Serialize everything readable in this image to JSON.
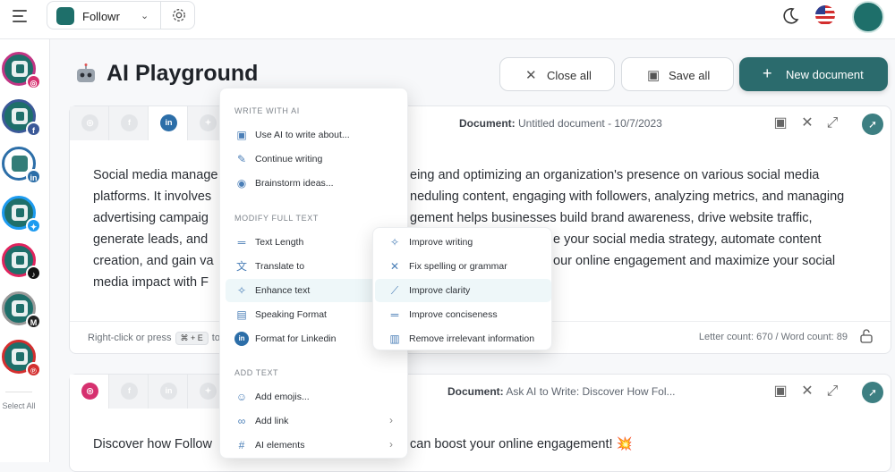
{
  "app": {
    "name": "Followr"
  },
  "colors": {
    "brand": "#1e6f6a",
    "accent": "#2b6b6d",
    "menu_icon": "#4b7fb7"
  },
  "sidebar": {
    "accounts": [
      {
        "network": "instagram",
        "badge_icon": "instagram-icon",
        "badge_color": "#d6306f"
      },
      {
        "network": "facebook",
        "badge_icon": "facebook-icon",
        "badge_color": "#3b5998",
        "badge_text": "f"
      },
      {
        "network": "linkedin",
        "badge_icon": "linkedin-icon",
        "badge_color": "#2c6ea8",
        "badge_text": "in"
      },
      {
        "network": "twitter",
        "badge_icon": "twitter-icon",
        "badge_color": "#1d9bf0"
      },
      {
        "network": "tiktok",
        "badge_icon": "tiktok-icon",
        "badge_color": "#111111"
      },
      {
        "network": "medium",
        "badge_icon": "medium-icon",
        "badge_color": "#222222",
        "badge_text": "M"
      },
      {
        "network": "pinterest",
        "badge_icon": "pinterest-icon",
        "badge_color": "#d32f2f"
      }
    ],
    "select_all": "Select All"
  },
  "page": {
    "title": "AI Playground"
  },
  "toolbar": {
    "close_all": "Close all",
    "save_all": "Save all",
    "new_document": "New document"
  },
  "documents": [
    {
      "label_prefix": "Document:",
      "label_value": "Untitled document - 10/7/2023",
      "lines": [
        "Social media manage",
        "platforms. It involves",
        "advertising campaig",
        "generate leads, and",
        "creation, and gain va",
        "media impact with F"
      ],
      "lines_right": [
        "eing and optimizing an organization's presence on various social media",
        "neduling content, engaging with followers, analyzing metrics, and managing",
        "gement helps businesses build brand awareness, drive website traffic,",
        "e your social media strategy, automate content",
        "our online engagement and maximize your social",
        ""
      ],
      "hint_prefix": "Right-click or press",
      "hint_key": "⌘ + E",
      "hint_suffix": "to",
      "counts": "Letter count: 670 / Word count: 89"
    },
    {
      "label_prefix": "Document:",
      "label_value": "Ask AI to Write: Discover How Fol...",
      "text_left": "Discover how Follow",
      "text_right": "can boost your online engagement! 💥"
    }
  ],
  "context_menu": {
    "write_with_ai": {
      "title": "WRITE WITH AI",
      "items": [
        {
          "label": "Use AI to write about...",
          "icon": "ai-chip-icon"
        },
        {
          "label": "Continue writing",
          "icon": "pencil-icon"
        },
        {
          "label": "Brainstorm ideas...",
          "icon": "lightbulb-icon"
        }
      ]
    },
    "modify_full_text": {
      "title": "MODIFY FULL TEXT",
      "items": [
        {
          "label": "Text Length",
          "icon": "text-length-icon"
        },
        {
          "label": "Translate to",
          "icon": "translate-icon"
        },
        {
          "label": "Enhance text",
          "icon": "magic-wand-icon"
        },
        {
          "label": "Speaking Format",
          "icon": "paint-roller-icon"
        },
        {
          "label": "Format for Linkedin",
          "icon": "linkedin-icon"
        }
      ]
    },
    "add_text": {
      "title": "ADD TEXT",
      "items": [
        {
          "label": "Add emojis...",
          "icon": "smiley-icon"
        },
        {
          "label": "Add link",
          "icon": "link-icon"
        },
        {
          "label": "AI elements",
          "icon": "hash-icon"
        }
      ]
    }
  },
  "submenu": {
    "items": [
      {
        "label": "Improve writing",
        "icon": "sparkle-wand-icon"
      },
      {
        "label": "Fix spelling or grammar",
        "icon": "tools-icon"
      },
      {
        "label": "Improve clarity",
        "icon": "wand-icon"
      },
      {
        "label": "Improve conciseness",
        "icon": "lines-icon"
      },
      {
        "label": "Remove irrelevant information",
        "icon": "eraser-icon"
      }
    ]
  }
}
